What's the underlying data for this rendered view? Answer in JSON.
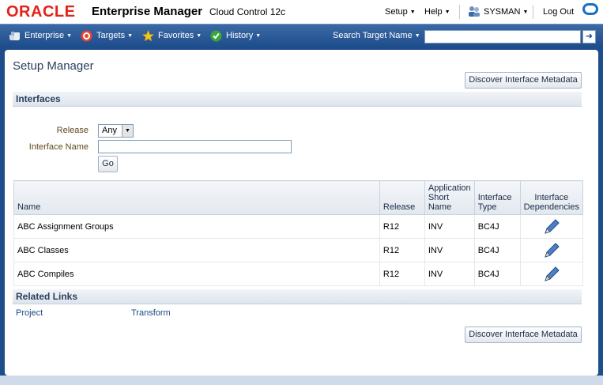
{
  "header": {
    "oracle_logo": "ORACLE",
    "app_title": "Enterprise Manager",
    "subtitle": "Cloud Control 12c",
    "setup_menu": "Setup",
    "help_menu": "Help",
    "user": "SYSMAN",
    "logout": "Log Out"
  },
  "navbar": {
    "enterprise": "Enterprise",
    "targets": "Targets",
    "favorites": "Favorites",
    "history": "History",
    "search_label": "Search Target Name",
    "search_value": ""
  },
  "page": {
    "title": "Setup Manager",
    "discover_button": "Discover Interface Metadata"
  },
  "interfaces": {
    "section_title": "Interfaces",
    "release_label": "Release",
    "release_value": "Any",
    "interface_name_label": "Interface Name",
    "interface_name_value": "",
    "go_button": "Go"
  },
  "table": {
    "columns": [
      "Name",
      "Release",
      "Application Short Name",
      "Interface Type",
      "Interface Dependencies"
    ],
    "rows": [
      {
        "name": "ABC Assignment Groups",
        "release": "R12",
        "app_short_name": "INV",
        "interface_type": "BC4J"
      },
      {
        "name": "ABC Classes",
        "release": "R12",
        "app_short_name": "INV",
        "interface_type": "BC4J"
      },
      {
        "name": "ABC Compiles",
        "release": "R12",
        "app_short_name": "INV",
        "interface_type": "BC4J"
      }
    ]
  },
  "related_links": {
    "section_title": "Related Links",
    "links": [
      "Project",
      "Transform"
    ]
  },
  "colors": {
    "brand_red": "#e2231a",
    "nav_blue": "#1e4d8b",
    "header_text": "#2a3f5c"
  }
}
